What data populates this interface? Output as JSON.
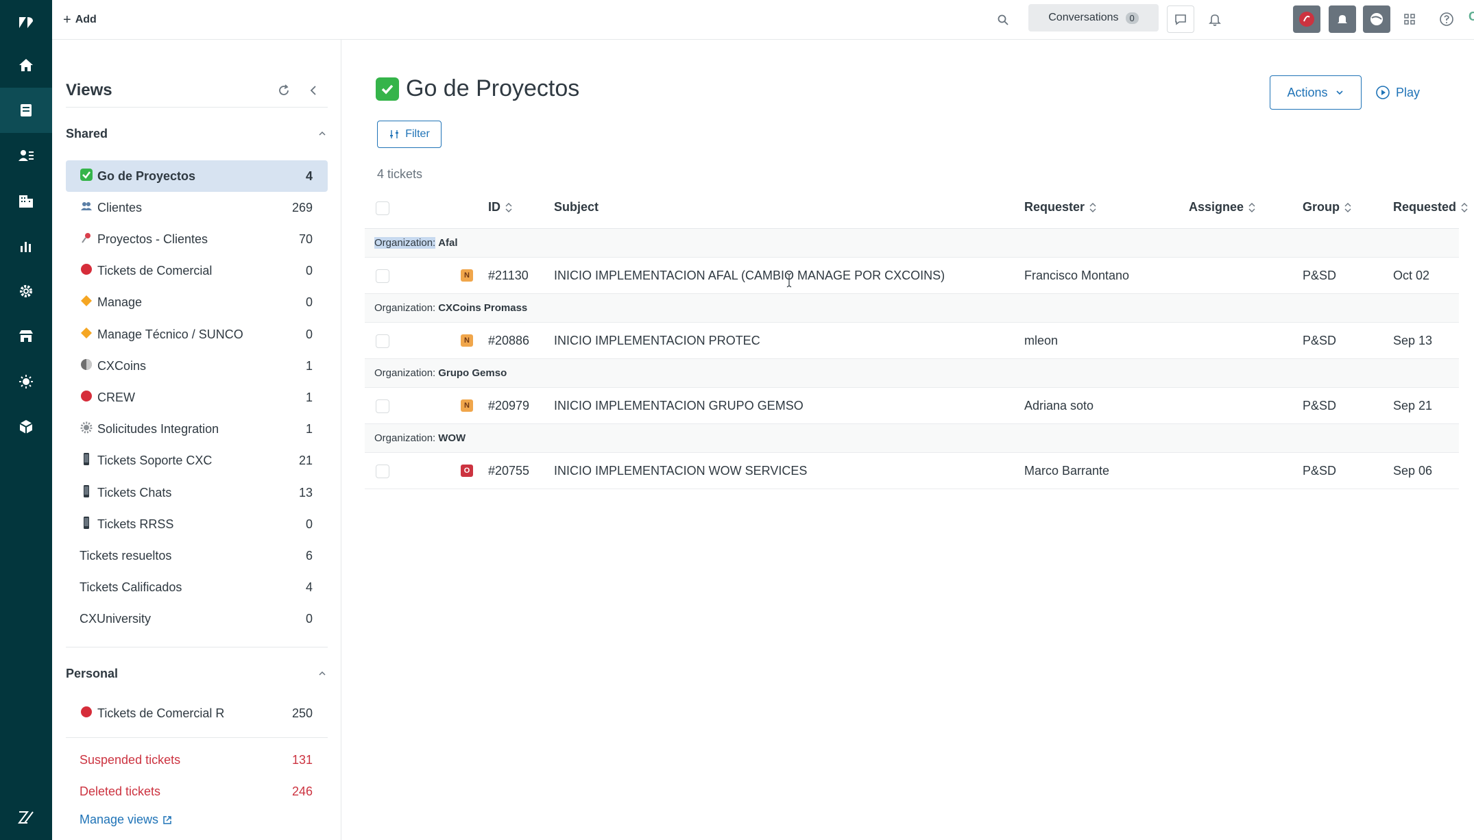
{
  "topbar": {
    "add_label": "Add",
    "conversations_label": "Conversations",
    "conversations_count": "0",
    "brand": "CXO"
  },
  "views": {
    "title": "Views",
    "shared_label": "Shared",
    "shared": [
      {
        "label": "Go de Proyectos",
        "count": "4",
        "emoji": "check",
        "selected": true
      },
      {
        "label": "Clientes",
        "count": "269",
        "emoji": "people"
      },
      {
        "label": "Proyectos - Clientes",
        "count": "70",
        "emoji": "pin"
      },
      {
        "label": "Tickets de Comercial",
        "count": "0",
        "emoji": "red-dot"
      },
      {
        "label": "Manage",
        "count": "0",
        "emoji": "diamond"
      },
      {
        "label": "Manage Técnico / SUNCO",
        "count": "0",
        "emoji": "diamond"
      },
      {
        "label": "CXCoins",
        "count": "1",
        "emoji": "coin"
      },
      {
        "label": "CREW",
        "count": "1",
        "emoji": "red-dot"
      },
      {
        "label": "Solicitudes Integration",
        "count": "1",
        "emoji": "gear"
      },
      {
        "label": "Tickets Soporte CXC",
        "count": "21",
        "emoji": "phone"
      },
      {
        "label": "Tickets Chats",
        "count": "13",
        "emoji": "phone"
      },
      {
        "label": "Tickets RRSS",
        "count": "0",
        "emoji": "phone"
      },
      {
        "label": "Tickets resueltos",
        "count": "6",
        "emoji": ""
      },
      {
        "label": "Tickets Calificados",
        "count": "4",
        "emoji": ""
      },
      {
        "label": "CXUniversity",
        "count": "0",
        "emoji": ""
      }
    ],
    "personal_label": "Personal",
    "personal": [
      {
        "label": "Tickets de Comercial R",
        "count": "250",
        "emoji": "red-dot"
      }
    ],
    "suspended_label": "Suspended tickets",
    "suspended_count": "131",
    "deleted_label": "Deleted tickets",
    "deleted_count": "246",
    "manage_views_label": "Manage views"
  },
  "main": {
    "title": "Go de Proyectos",
    "actions_label": "Actions",
    "play_label": "Play",
    "filter_label": "Filter",
    "ticket_count": "4 tickets",
    "columns": {
      "id": "ID",
      "subject": "Subject",
      "requester": "Requester",
      "assignee": "Assignee",
      "group": "Group",
      "requested": "Requested"
    },
    "group_prefix": "Organization:",
    "groups": [
      {
        "org": "Afal",
        "ticket": {
          "status": "N",
          "id": "#21130",
          "subject": "INICIO IMPLEMENTACION AFAL (CAMBIO MANAGE POR CXCOINS)",
          "requester": "Francisco Montano",
          "assignee": "",
          "group": "P&SD",
          "requested": "Oct 02"
        }
      },
      {
        "org": "CXCoins Promass",
        "ticket": {
          "status": "N",
          "id": "#20886",
          "subject": "INICIO IMPLEMENTACION PROTEC",
          "requester": "mleon",
          "assignee": "",
          "group": "P&SD",
          "requested": "Sep 13"
        }
      },
      {
        "org": "Grupo Gemso",
        "ticket": {
          "status": "N",
          "id": "#20979",
          "subject": "INICIO IMPLEMENTACION GRUPO GEMSO",
          "requester": "Adriana soto",
          "assignee": "",
          "group": "P&SD",
          "requested": "Sep 21"
        }
      },
      {
        "org": "WOW",
        "ticket": {
          "status": "O",
          "id": "#20755",
          "subject": "INICIO IMPLEMENTACION WOW SERVICES",
          "requester": "Marco Barrante",
          "assignee": "",
          "group": "P&SD",
          "requested": "Sep 06"
        }
      }
    ]
  },
  "colors": {
    "nav_bg": "#03363d",
    "accent": "#1f73b7",
    "selected_bg": "#d7e3f1",
    "danger": "#cc3340",
    "status_new": "#f0a64b",
    "status_open": "#cc3340"
  }
}
